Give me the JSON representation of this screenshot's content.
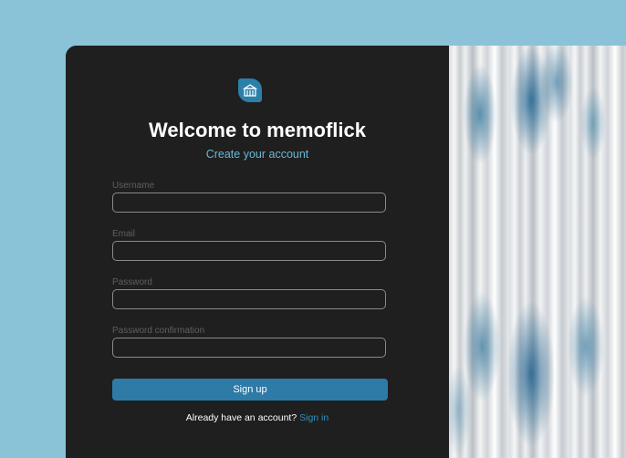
{
  "app": {
    "title": "Welcome to memoflick",
    "subtitle": "Create your account",
    "logo_icon": "archive-box-icon"
  },
  "form": {
    "username": {
      "label": "Username",
      "value": "",
      "placeholder": ""
    },
    "email": {
      "label": "Email",
      "value": "",
      "placeholder": ""
    },
    "password": {
      "label": "Password",
      "value": "",
      "placeholder": ""
    },
    "password_confirmation": {
      "label": "Password confirmation",
      "value": "",
      "placeholder": ""
    },
    "submit_label": "Sign up"
  },
  "footer": {
    "prompt": "Already have an account?",
    "link_label": "Sign in"
  },
  "colors": {
    "background": "#8ac3d8",
    "panel": "#1f1f1f",
    "accent": "#2d7ba6",
    "subtitle": "#6ab7d9"
  }
}
